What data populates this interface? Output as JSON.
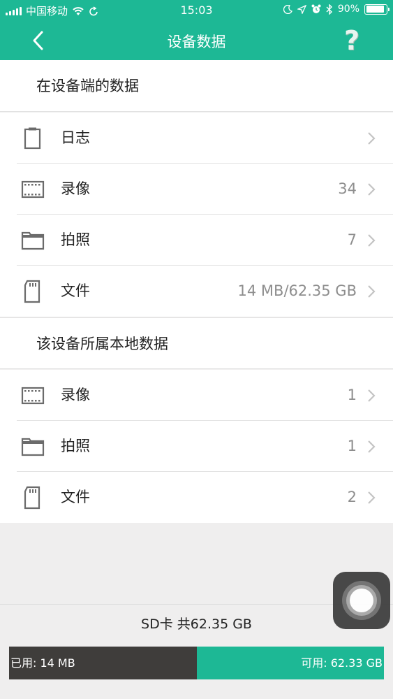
{
  "status_bar": {
    "carrier": "中国移动",
    "time": "15:03",
    "battery_percent": "90%",
    "battery_level": 0.9,
    "icons": [
      "signal-icon",
      "wifi-icon",
      "sync-icon",
      "moon-icon",
      "location-icon",
      "alarm-icon",
      "bluetooth-icon",
      "battery-icon"
    ]
  },
  "header": {
    "title": "设备数据",
    "back_icon": "back-arrow-icon",
    "help_label": "?"
  },
  "section_device": {
    "title": "在设备端的数据",
    "items": [
      {
        "icon": "log-icon",
        "label": "日志",
        "value": ""
      },
      {
        "icon": "video-icon",
        "label": "录像",
        "value": "34"
      },
      {
        "icon": "folder-icon",
        "label": "拍照",
        "value": "7"
      },
      {
        "icon": "sdcard-icon",
        "label": "文件",
        "value": "14 MB/62.35 GB"
      }
    ]
  },
  "section_local": {
    "title": "该设备所属本地数据",
    "items": [
      {
        "icon": "video-icon",
        "label": "录像",
        "value": "1"
      },
      {
        "icon": "folder-icon",
        "label": "拍照",
        "value": "1"
      },
      {
        "icon": "sdcard-icon",
        "label": "文件",
        "value": "2"
      }
    ]
  },
  "storage": {
    "total_label": "SD卡 共62.35 GB",
    "used_label": "已用: 14 MB",
    "free_label": "可用: 62.33 GB",
    "used_fraction": 0.5
  },
  "colors": {
    "accent": "#1db895",
    "used_bar": "#3f3d3b",
    "background": "#efeeee"
  }
}
